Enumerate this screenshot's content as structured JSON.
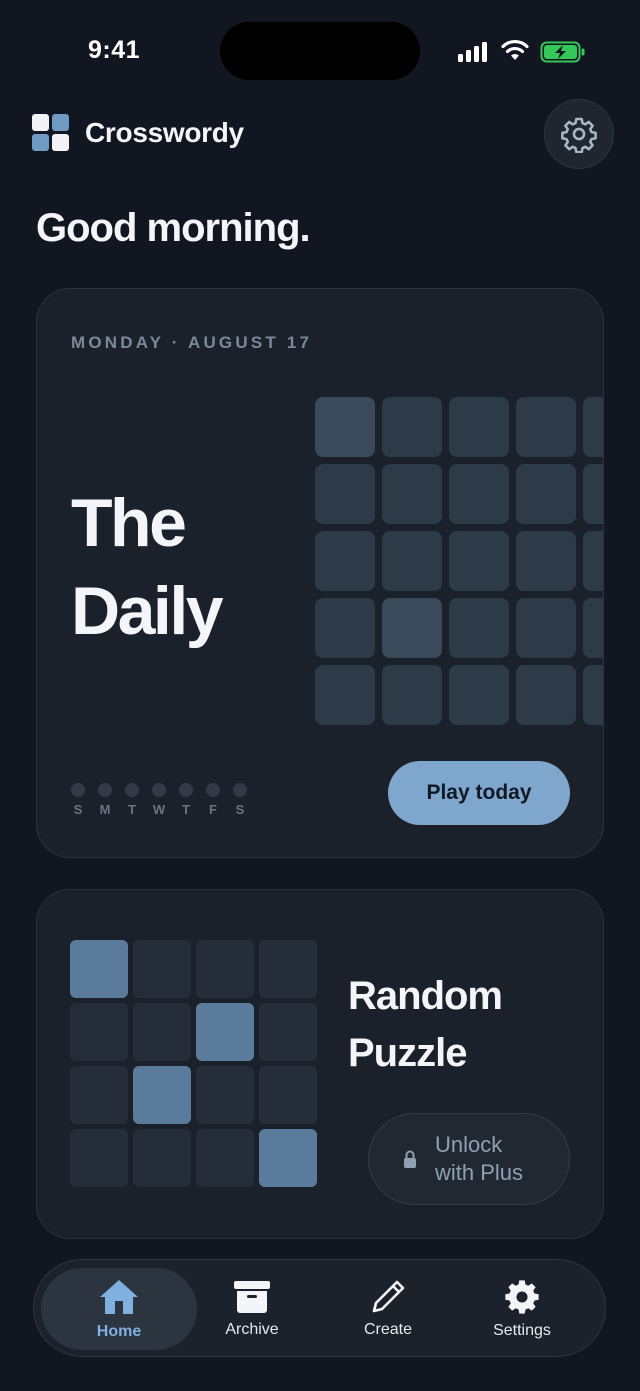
{
  "status_bar": {
    "time": "9:41"
  },
  "header": {
    "app_name": "Crosswordy",
    "settings_icon": "gear-icon"
  },
  "greeting": "Good morning.",
  "daily": {
    "date": "MONDAY · AUGUST 17",
    "title_line1": "The",
    "title_line2": "Daily",
    "week_days": [
      "S",
      "M",
      "T",
      "W",
      "T",
      "F",
      "S"
    ],
    "play_label": "Play today"
  },
  "random": {
    "title_line1": "Random",
    "title_line2": "Puzzle",
    "unlock_line1": "Unlock",
    "unlock_line2": "with Plus",
    "lock_icon": "lock-icon"
  },
  "tabs": [
    {
      "label": "Home",
      "icon": "home-icon",
      "active": true
    },
    {
      "label": "Archive",
      "icon": "archive-icon",
      "active": false
    },
    {
      "label": "Create",
      "icon": "pencil-icon",
      "active": false
    },
    {
      "label": "Settings",
      "icon": "gear-icon",
      "active": false
    }
  ],
  "colors": {
    "background": "#111620",
    "card": "#1b212b",
    "accent": "#7fa6cc",
    "active_tab_label": "#7fb0e0",
    "battery_green": "#34c759"
  }
}
